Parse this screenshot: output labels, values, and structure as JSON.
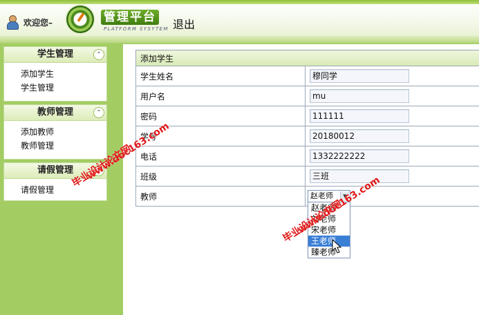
{
  "header": {
    "welcome": "欢迎您–",
    "platform_title": "管理平台",
    "platform_subtitle": "PLATFORM SYSYTEM",
    "logout": "退出"
  },
  "sidebar": {
    "panels": [
      {
        "title": "学生管理",
        "items": [
          "添加学生",
          "学生管理"
        ]
      },
      {
        "title": "教师管理",
        "items": [
          "添加教师",
          "教师管理"
        ]
      },
      {
        "title": "请假管理",
        "items": [
          "请假管理"
        ]
      }
    ]
  },
  "form": {
    "title": "添加学生",
    "fields": [
      {
        "label": "学生姓名",
        "value": "穆同学"
      },
      {
        "label": "用户名",
        "value": "mu"
      },
      {
        "label": "密码",
        "value": "111111"
      },
      {
        "label": "学号",
        "value": "20180012"
      },
      {
        "label": "电话",
        "value": "1332222222"
      },
      {
        "label": "班级",
        "value": "三班"
      }
    ],
    "teacher_label": "教师",
    "teacher_selected": "赵老师",
    "teacher_options": [
      "赵老师",
      "刘老师",
      "宋老师",
      "王老师",
      "臻老师"
    ],
    "teacher_highlighted": "王老师"
  },
  "watermark": {
    "line1": "毕业设计论文网",
    "line2": "www.doc163.com"
  },
  "colors": {
    "sidebar_bg": "#a3cd63",
    "accent_green": "#4a8b1d",
    "selection_blue": "#3a7fd6",
    "watermark_red": "#e01818"
  }
}
